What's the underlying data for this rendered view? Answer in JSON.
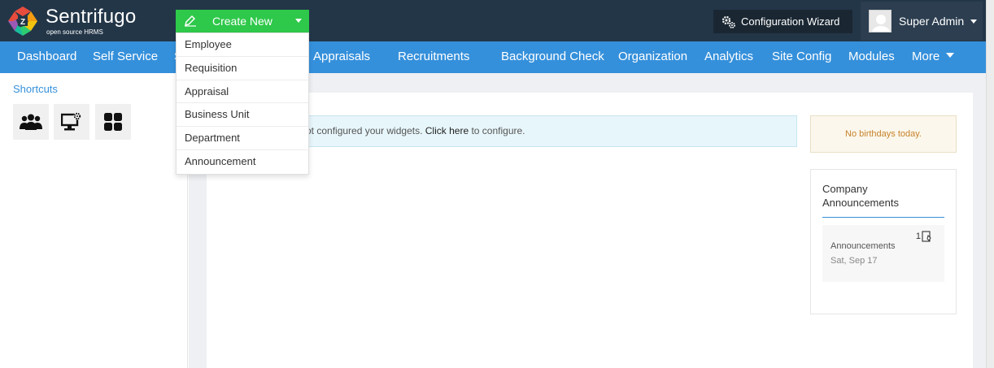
{
  "app": {
    "name": "Sentrifugo",
    "tagline": "open source HRMS"
  },
  "header": {
    "create_new_label": "Create New",
    "config_wizard_label": "Configuration Wizard",
    "user_name": "Super Admin"
  },
  "create_menu": {
    "items": [
      "Employee",
      "Requisition",
      "Appraisal",
      "Business Unit",
      "Department",
      "Announcement"
    ]
  },
  "nav": {
    "items": [
      "Dashboard",
      "Self Service",
      "S",
      "Appraisals",
      "Recruitments",
      "Background Check",
      "Organization",
      "Analytics",
      "Site Config",
      "Modules",
      "More"
    ]
  },
  "sidebar": {
    "shortcuts_title": "Shortcuts",
    "shortcut_icons": [
      "users-icon",
      "monitor-settings-icon",
      "grid-icon"
    ]
  },
  "main": {
    "widgets_message_before": "ot configured your widgets.",
    "widgets_click_here": "Click here",
    "widgets_message_after": "to configure.",
    "birthday_message": "No birthdays today.",
    "announcements": {
      "title": "Company Announcements",
      "count": "1",
      "label": "Announcements",
      "date": "Sat, Sep 17"
    }
  },
  "colors": {
    "topbar": "#233648",
    "nav": "#3590db",
    "create_new": "#2ec84a",
    "accent": "#3590db"
  }
}
